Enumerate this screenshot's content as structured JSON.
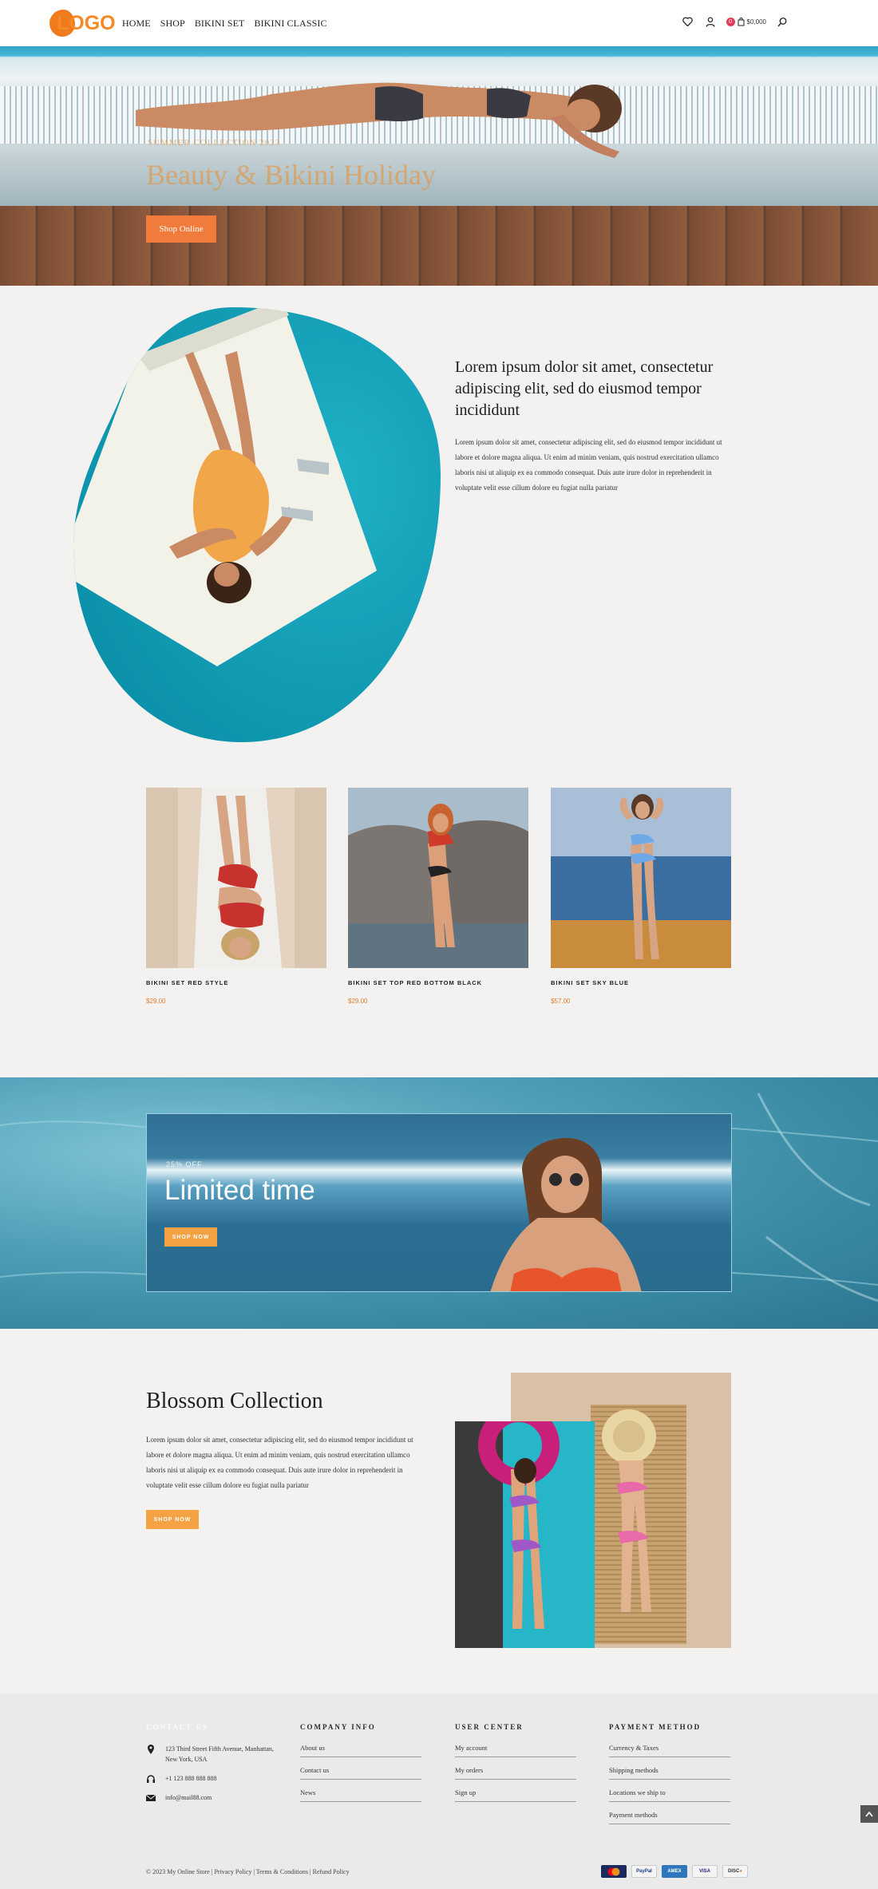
{
  "header": {
    "logo_text": "LOGO",
    "nav": [
      "HOME",
      "SHOP",
      "BIKINI SET",
      "BIKINI CLASSIC"
    ],
    "cart_count": "0",
    "cart_total": "$0,000",
    "icons": [
      "heart-icon",
      "user-icon",
      "cart-icon",
      "search-icon"
    ]
  },
  "hero": {
    "subtitle": "SUMMER COLLECTION 2023",
    "title": "Beauty & Bikini Holiday",
    "button": "Shop Online"
  },
  "intro": {
    "title": "Lorem ipsum dolor sit amet, consectetur adipiscing elit, sed do eiusmod tempor incididunt",
    "body": "Lorem ipsum dolor sit amet, consectetur adipiscing elit, sed do eiusmod tempor incididunt ut labore et dolore magna aliqua. Ut enim ad minim veniam, quis nostrud exercitation ullamco laboris nisi ut aliquip ex ea commodo consequat. Duis aute irure dolor in reprehenderit in voluptate velit esse cillum dolore eu fugiat nulla pariatur"
  },
  "products": [
    {
      "name": "BIKINI SET RED STYLE",
      "price": "$29.00"
    },
    {
      "name": "BIKINI SET TOP RED BOTTOM BLACK",
      "price": "$29.00"
    },
    {
      "name": "BIKINI SET SKY BLUE",
      "price": "$57.00"
    }
  ],
  "promo": {
    "discount": "25% OFF",
    "title": "Limited time",
    "button": "SHOP NOW"
  },
  "blossom": {
    "title": "Blossom Collection",
    "body": "Lorem ipsum dolor sit amet, consectetur adipiscing elit, sed do eiusmod tempor incididunt ut labore et dolore magna aliqua. Ut enim ad minim veniam, quis nostrud exercitation ullamco laboris nisi ut aliquip ex ea commodo consequat. Duis aute irure dolor in reprehenderit in voluptate velit esse cillum dolore eu fugiat nulla pariatur",
    "button": "SHOP NOW"
  },
  "footer": {
    "contact": {
      "heading": "CONTACT US",
      "address": "123 Third Street Fifth Avenue, Manhattan, New York, USA",
      "phone": "+1 123 888 888 888",
      "email": "info@mail88.com"
    },
    "company": {
      "heading": "COMPANY INFO",
      "links": [
        "About us",
        "Contact us",
        "News"
      ]
    },
    "user_center": {
      "heading": "USER CENTER",
      "links": [
        "My account",
        "My orders",
        "Sign up"
      ]
    },
    "payment": {
      "heading": "PAYMENT METHOD",
      "links": [
        "Currency & Taxes",
        "Shipping methods",
        "Locations we ship to",
        "Payment methods"
      ]
    },
    "copyright": "© 2023 My Online Store | Privacy Policy | Terms & Conditions | Refund Policy",
    "payment_logos": [
      "Mastercard",
      "PayPal",
      "American Express",
      "VISA",
      "Discover"
    ]
  },
  "colors": {
    "accent": "#f07b3a",
    "button_orange": "#f5a245",
    "price": "#e07a2a",
    "background": "#f3f2f0",
    "footer_bg": "#eaeaea"
  }
}
